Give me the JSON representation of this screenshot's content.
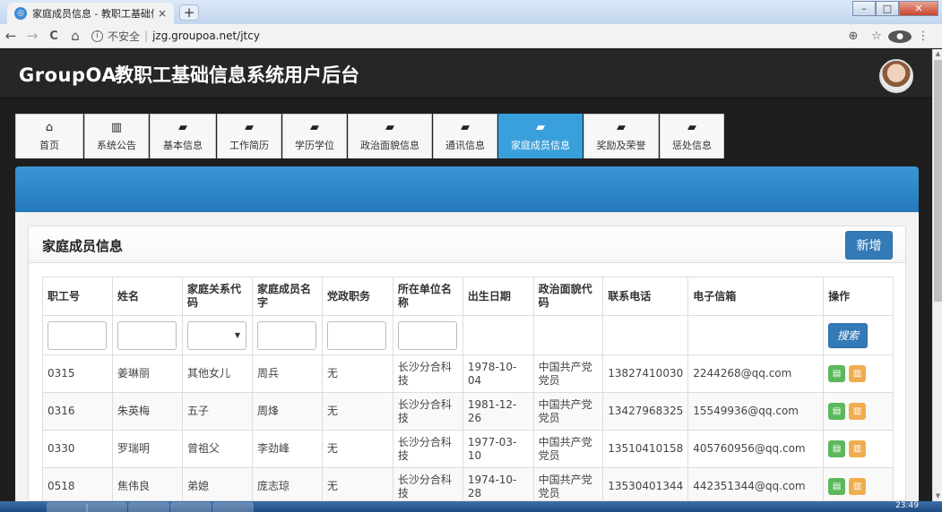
{
  "browser": {
    "tab_title": "家庭成员信息 - 教职工基础信息系",
    "tab_close": "×",
    "new_tab": "+",
    "security_label": "不安全",
    "url": "jzg.groupoa.net/jtcy",
    "back": "←",
    "forward": "→",
    "reload": "C",
    "home": "⌂",
    "zoom": "⊕",
    "star": "☆",
    "menu": "⋮",
    "win_min": "–",
    "win_max": "□",
    "win_close": "✕"
  },
  "header": {
    "logo": "GroupOA",
    "logo_mark": "®",
    "title": "教职工基础信息系统用户后台"
  },
  "nav": [
    {
      "label": "首页",
      "icon": "home-icon",
      "glyph": "⌂",
      "width": 76
    },
    {
      "label": "系统公告",
      "icon": "bar-chart-icon",
      "glyph": "▥",
      "width": 72
    },
    {
      "label": "基本信息",
      "icon": "book-icon",
      "glyph": "▰",
      "width": 74
    },
    {
      "label": "工作简历",
      "icon": "book-icon",
      "glyph": "▰",
      "width": 72
    },
    {
      "label": "学历学位",
      "icon": "book-icon",
      "glyph": "▰",
      "width": 72
    },
    {
      "label": "政治面貌信息",
      "icon": "book-icon",
      "glyph": "▰",
      "width": 94
    },
    {
      "label": "通讯信息",
      "icon": "book-icon",
      "glyph": "▰",
      "width": 72
    },
    {
      "label": "家庭成员信息",
      "icon": "book-icon",
      "glyph": "▰",
      "width": 94,
      "active": true
    },
    {
      "label": "奖励及荣誉",
      "icon": "book-icon",
      "glyph": "▰",
      "width": 84
    },
    {
      "label": "惩处信息",
      "icon": "book-icon",
      "glyph": "▰",
      "width": 72
    }
  ],
  "panel": {
    "title": "家庭成员信息",
    "add_label": "新增",
    "search_label": "搜索"
  },
  "table": {
    "columns": [
      {
        "label": "职工号",
        "w": 78
      },
      {
        "label": "姓名",
        "w": 78
      },
      {
        "label": "家庭关系代码",
        "w": 78
      },
      {
        "label": "家庭成员名字",
        "w": 78
      },
      {
        "label": "党政职务",
        "w": 79
      },
      {
        "label": "所在单位名称",
        "w": 78
      },
      {
        "label": "出生日期",
        "w": 79
      },
      {
        "label": "政治面貌代码",
        "w": 78
      },
      {
        "label": "联系电话",
        "w": 94
      },
      {
        "label": "电子信箱",
        "w": 151
      },
      {
        "label": "操作",
        "w": 78
      }
    ],
    "rows": [
      [
        "0315",
        "姜琳丽",
        "其他女儿",
        "周兵",
        "无",
        "长沙分合科技",
        "1978-10-04",
        "中国共产党党员",
        "13827410030",
        "2244268@qq.com"
      ],
      [
        "0316",
        "朱英梅",
        "五子",
        "周烽",
        "无",
        "长沙分合科技",
        "1981-12-26",
        "中国共产党党员",
        "13427968325",
        "15549936@qq.com"
      ],
      [
        "0330",
        "罗瑞明",
        "曾祖父",
        "李劲峰",
        "无",
        "长沙分合科技",
        "1977-03-10",
        "中国共产党党员",
        "13510410158",
        "405760956@qq.com"
      ],
      [
        "0518",
        "焦伟良",
        "弟媳",
        "庞志琼",
        "无",
        "长沙分合科技",
        "1974-10-28",
        "中国共产党党员",
        "13530401344",
        "442351344@qq.com"
      ]
    ]
  },
  "taskbar": {
    "time": "23:49"
  }
}
